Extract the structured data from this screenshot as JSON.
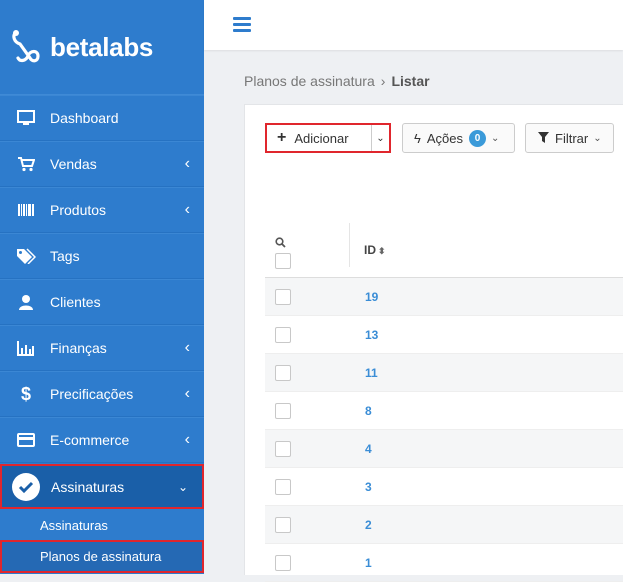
{
  "brand": {
    "name": "betalabs"
  },
  "sidebar": {
    "items": [
      {
        "label": "Dashboard",
        "icon": "monitor-icon",
        "chevron": false
      },
      {
        "label": "Vendas",
        "icon": "cart-icon",
        "chevron": true
      },
      {
        "label": "Produtos",
        "icon": "barcode-icon",
        "chevron": true
      },
      {
        "label": "Tags",
        "icon": "tags-icon",
        "chevron": false
      },
      {
        "label": "Clientes",
        "icon": "user-icon",
        "chevron": false
      },
      {
        "label": "Finanças",
        "icon": "bar-chart-icon",
        "chevron": true
      },
      {
        "label": "Precificações",
        "icon": "dollar-icon",
        "chevron": true
      },
      {
        "label": "E-commerce",
        "icon": "credit-card-icon",
        "chevron": true
      },
      {
        "label": "Assinaturas",
        "icon": "check-circle-icon",
        "chevron": true,
        "expanded": true
      }
    ],
    "subitems": [
      {
        "label": "Assinaturas"
      },
      {
        "label": "Planos de assinatura",
        "selected": true
      }
    ]
  },
  "breadcrumb": {
    "parent": "Planos de assinatura",
    "separator": "›",
    "current": "Listar"
  },
  "toolbar": {
    "add_label": "Adicionar",
    "actions_label": "Ações",
    "actions_count": "0",
    "filter_label": "Filtrar"
  },
  "table": {
    "id_header": "ID",
    "rows": [
      "19",
      "13",
      "11",
      "8",
      "4",
      "3",
      "2",
      "1"
    ]
  },
  "colors": {
    "sidebar": "#2e7ccd",
    "highlight": "#e0262d",
    "link": "#3a8dd6"
  }
}
